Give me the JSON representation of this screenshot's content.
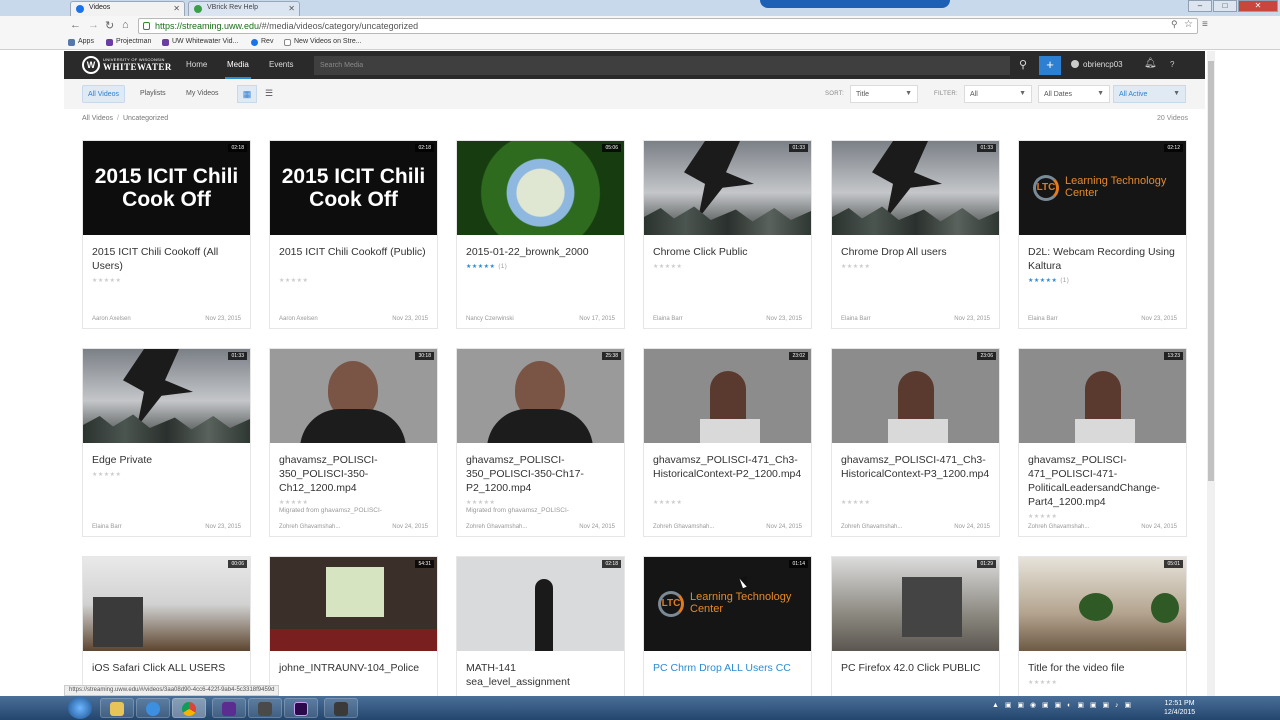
{
  "browser": {
    "tabs": [
      {
        "label": "Videos"
      },
      {
        "label": "VBrick Rev Help"
      }
    ],
    "url_host": "https://streaming.uww.edu",
    "url_path": "/#/media/videos/category/uncategorized",
    "bookmarks": [
      {
        "label": "Apps"
      },
      {
        "label": "Projectman"
      },
      {
        "label": "UW Whitewater Vid..."
      },
      {
        "label": "Rev"
      },
      {
        "label": "New Videos on Stre..."
      }
    ]
  },
  "header": {
    "logo_small": "UNIVERSITY OF WISCONSIN",
    "logo_big": "WHITEWATER",
    "nav": [
      {
        "label": "Home"
      },
      {
        "label": "Media"
      },
      {
        "label": "Events"
      }
    ],
    "search_placeholder": "Search Media",
    "add_symbol": "+",
    "username": "obriencp03",
    "help_symbol": "?"
  },
  "filters": {
    "view_tabs": [
      {
        "label": "All Videos"
      },
      {
        "label": "Playlists"
      },
      {
        "label": "My Videos"
      }
    ],
    "sort_label": "SORT:",
    "sort_value": "Title",
    "filter_label": "FILTER:",
    "filter_value": "All",
    "dates_value": "All Dates",
    "status_value": "All Active"
  },
  "breadcrumb": {
    "root": "All Videos",
    "current": "Uncategorized"
  },
  "video_count": "20 Videos",
  "videos": [
    {
      "title": "2015 ICIT Chili Cookoff (All Users)",
      "duration": "02:18",
      "thumb_text": "2015 ICIT Chili Cook Off",
      "owner": "Aaron Axelsen",
      "date": "Nov 23, 2015",
      "rating": "",
      "desc": ""
    },
    {
      "title": "2015 ICIT Chili Cookoff (Public)",
      "duration": "02:18",
      "thumb_text": "2015 ICIT Chili Cook Off",
      "owner": "Aaron Axelsen",
      "date": "Nov 23, 2015",
      "rating": "",
      "desc": ""
    },
    {
      "title": "2015-01-22_brownk_2000",
      "duration": "05:06",
      "thumb_text": "",
      "owner": "Nancy Czerwinski",
      "date": "Nov 17, 2015",
      "rating": "(1)",
      "desc": ""
    },
    {
      "title": "Chrome Click Public",
      "duration": "01:33",
      "thumb_text": "",
      "owner": "Elaina Barr",
      "date": "Nov 23, 2015",
      "rating": "",
      "desc": ""
    },
    {
      "title": "Chrome Drop All users",
      "duration": "01:33",
      "thumb_text": "",
      "owner": "Elaina Barr",
      "date": "Nov 23, 2015",
      "rating": "",
      "desc": ""
    },
    {
      "title": "D2L: Webcam Recording Using Kaltura",
      "duration": "02:12",
      "thumb_text": "Learning Technology Center",
      "owner": "Elaina Barr",
      "date": "Nov 23, 2015",
      "rating": "(1)",
      "desc": ""
    },
    {
      "title": "Edge Private",
      "duration": "01:33",
      "thumb_text": "",
      "owner": "Elaina Barr",
      "date": "Nov 23, 2015",
      "rating": "",
      "desc": ""
    },
    {
      "title": "ghavamsz_POLISCI-350_POLISCI-350-Ch12_1200.mp4",
      "duration": "30:18",
      "thumb_text": "",
      "owner": "Zohreh Ghavamshah...",
      "date": "Nov 24, 2015",
      "rating": "",
      "desc": "Migrated from ghavamsz_POLISCI-"
    },
    {
      "title": "ghavamsz_POLISCI-350_POLISCI-350-Ch17-P2_1200.mp4",
      "duration": "25:38",
      "thumb_text": "",
      "owner": "Zohreh Ghavamshah...",
      "date": "Nov 24, 2015",
      "rating": "",
      "desc": "Migrated from ghavamsz_POLISCI-"
    },
    {
      "title": "ghavamsz_POLISCI-471_Ch3-HistoricalContext-P2_1200.mp4",
      "duration": "23:02",
      "thumb_text": "",
      "owner": "Zohreh Ghavamshah...",
      "date": "Nov 24, 2015",
      "rating": "",
      "desc": ""
    },
    {
      "title": "ghavamsz_POLISCI-471_Ch3-HistoricalContext-P3_1200.mp4",
      "duration": "23:06",
      "thumb_text": "",
      "owner": "Zohreh Ghavamshah...",
      "date": "Nov 24, 2015",
      "rating": "",
      "desc": ""
    },
    {
      "title": "ghavamsz_POLISCI-471_POLISCI-471-PoliticalLeadersandChange-Part4_1200.mp4",
      "duration": "13:23",
      "thumb_text": "",
      "owner": "Zohreh Ghavamshah...",
      "date": "Nov 24, 2015",
      "rating": "",
      "desc": ""
    },
    {
      "title": "iOS Safari Click ALL USERS",
      "duration": "00:06",
      "thumb_text": "",
      "owner": "",
      "date": "",
      "rating": "",
      "desc": ""
    },
    {
      "title": "johne_INTRAUNV-104_Police",
      "duration": "54:31",
      "thumb_text": "",
      "owner": "",
      "date": "",
      "rating": "",
      "desc": ""
    },
    {
      "title": "MATH-141 sea_level_assignment",
      "duration": "02:18",
      "thumb_text": "",
      "owner": "",
      "date": "",
      "rating": "",
      "desc": ""
    },
    {
      "title": "PC Chrm Drop ALL Users CC",
      "duration": "01:14",
      "thumb_text": "Learning Technology Center",
      "owner": "",
      "date": "",
      "rating": "",
      "desc": ""
    },
    {
      "title": "PC Firefox 42.0 Click PUBLIC",
      "duration": "01:29",
      "thumb_text": "",
      "owner": "",
      "date": "",
      "rating": "",
      "desc": ""
    },
    {
      "title": "Title for the video file",
      "duration": "05:01",
      "thumb_text": "",
      "owner": "",
      "date": "",
      "rating": "",
      "desc": ""
    }
  ],
  "status_url": "https://streaming.uww.edu/#/videos/3aa08d90-4cc6-422f-9ab4-5c3318f9459d",
  "clock": {
    "time": "12:51 PM",
    "date": "12/4/2015"
  }
}
